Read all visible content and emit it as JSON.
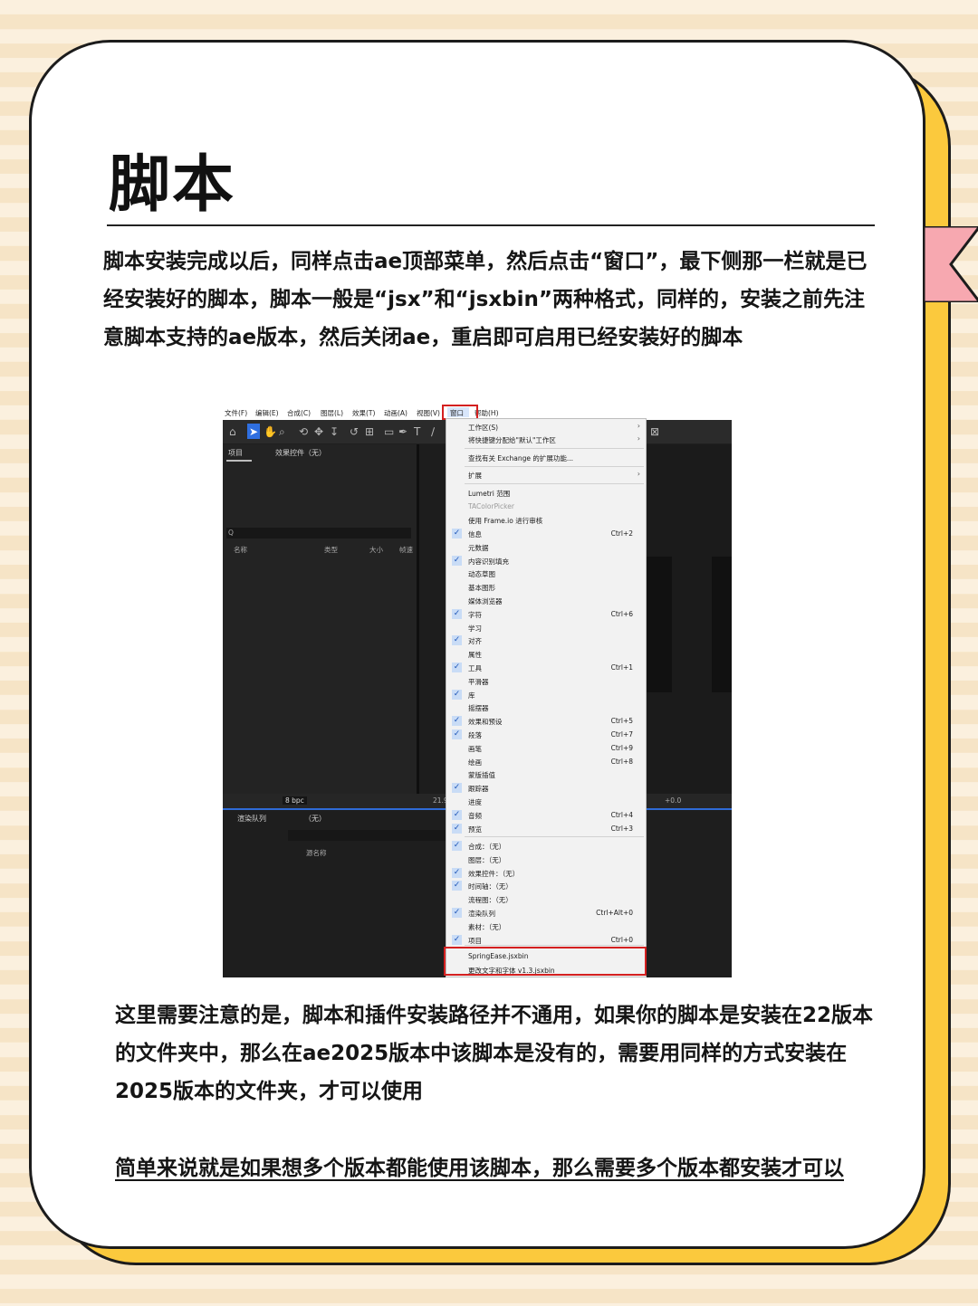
{
  "page": {
    "title": "脚本",
    "paragraph1": "脚本安装完成以后，同样点击ae顶部菜单，然后点击“窗口”，最下侧那一栏就是已经安装好的脚本，脚本一般是“jsx”和“jsxbin”两种格式，同样的，安装之前先注意脚本支持的ae版本，然后关闭ae，重启即可启用已经安装好的脚本",
    "paragraph2": "这里需要注意的是，脚本和插件安装路径并不通用，如果你的脚本是安装在22版本的文件夹中，那么在ae2025版本中该脚本是没有的，需要用同样的方式安装在2025版本的文件夹，才可以使用",
    "paragraph3": "简单来说就是如果想多个版本都能使用该脚本，那么需要多个版本都安装才可以"
  },
  "colors": {
    "card_bg": "#ffffff",
    "shadow": "#fbc93d",
    "ribbon": "#f7a8b0",
    "highlight_red": "#d42020",
    "ae_blue": "#2f6fe0"
  },
  "ae": {
    "menubar": [
      "文件(F)",
      "编辑(E)",
      "合成(C)",
      "图层(L)",
      "效果(T)",
      "动画(A)",
      "视图(V)",
      "窗口",
      "帮助(H)"
    ],
    "project_tab": "项目",
    "effects_tab": "效果控件（无）",
    "search_glyph": "Q",
    "col_name": "名称",
    "col_type": "类型",
    "col_size": "大小",
    "col_fps": "帧速",
    "bpc": "8 bpc",
    "render_queue_tab": "渲染队列",
    "none_tab": "（无）",
    "source_name": "源名称",
    "zoom_val": "21.9",
    "time_val": "+0.0",
    "window_menu": {
      "workspace": "工作区(S)",
      "assign_shortcut": "将快捷键分配给\"默认\"工作区",
      "find_exchange": "查找有关 Exchange 的扩展功能...",
      "extensions": "扩展",
      "lumetri": "Lumetri 范围",
      "tacolor": "TAColorPicker",
      "frameio": "使用 Frame.io 进行审核",
      "items": [
        {
          "label": "信息",
          "checked": true,
          "shortcut": "Ctrl+2"
        },
        {
          "label": "元数据",
          "checked": false,
          "shortcut": ""
        },
        {
          "label": "内容识别填充",
          "checked": true,
          "shortcut": ""
        },
        {
          "label": "动态草图",
          "checked": false,
          "shortcut": ""
        },
        {
          "label": "基本图形",
          "checked": false,
          "shortcut": ""
        },
        {
          "label": "媒体浏览器",
          "checked": false,
          "shortcut": ""
        },
        {
          "label": "字符",
          "checked": true,
          "shortcut": "Ctrl+6"
        },
        {
          "label": "学习",
          "checked": false,
          "shortcut": ""
        },
        {
          "label": "对齐",
          "checked": true,
          "shortcut": ""
        },
        {
          "label": "属性",
          "checked": false,
          "shortcut": ""
        },
        {
          "label": "工具",
          "checked": true,
          "shortcut": "Ctrl+1"
        },
        {
          "label": "平滑器",
          "checked": false,
          "shortcut": ""
        },
        {
          "label": "库",
          "checked": true,
          "shortcut": ""
        },
        {
          "label": "摇摆器",
          "checked": false,
          "shortcut": ""
        },
        {
          "label": "效果和预设",
          "checked": true,
          "shortcut": "Ctrl+5"
        },
        {
          "label": "段落",
          "checked": true,
          "shortcut": "Ctrl+7"
        },
        {
          "label": "画笔",
          "checked": false,
          "shortcut": "Ctrl+9"
        },
        {
          "label": "绘画",
          "checked": false,
          "shortcut": "Ctrl+8"
        },
        {
          "label": "蒙版插值",
          "checked": false,
          "shortcut": ""
        },
        {
          "label": "跟踪器",
          "checked": true,
          "shortcut": ""
        },
        {
          "label": "进度",
          "checked": false,
          "shortcut": ""
        },
        {
          "label": "音频",
          "checked": true,
          "shortcut": "Ctrl+4"
        },
        {
          "label": "预览",
          "checked": true,
          "shortcut": "Ctrl+3"
        }
      ],
      "panels": [
        {
          "label": "合成：（无）",
          "checked": true,
          "shortcut": ""
        },
        {
          "label": "图层：（无）",
          "checked": false,
          "shortcut": ""
        },
        {
          "label": "效果控件：（无）",
          "checked": true,
          "shortcut": ""
        },
        {
          "label": "时间轴：（无）",
          "checked": true,
          "shortcut": ""
        },
        {
          "label": "流程图：（无）",
          "checked": false,
          "shortcut": ""
        },
        {
          "label": "渲染队列",
          "checked": true,
          "shortcut": "Ctrl+Alt+0"
        },
        {
          "label": "素材：（无）",
          "checked": false,
          "shortcut": ""
        },
        {
          "label": "项目",
          "checked": true,
          "shortcut": "Ctrl+0"
        }
      ],
      "scripts": [
        "SpringEase.jsxbin",
        "更改文字和字体 v1.3.jsxbin"
      ]
    }
  }
}
